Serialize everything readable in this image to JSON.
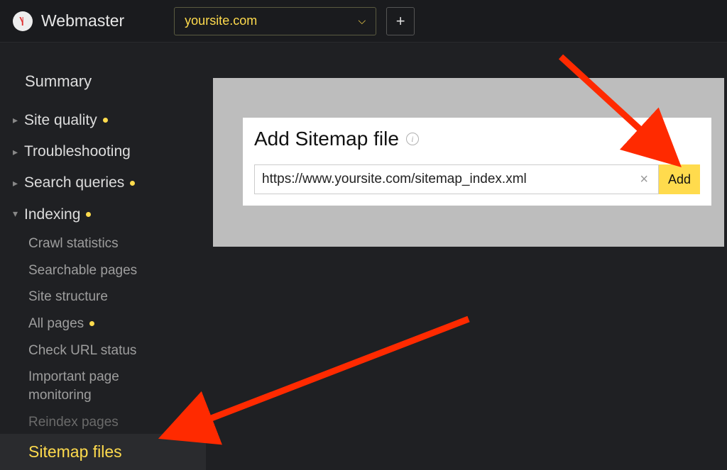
{
  "header": {
    "brand": "Webmaster",
    "site_selector_value": "yoursite.com"
  },
  "sidebar": {
    "summary": "Summary",
    "items": [
      {
        "label": "Site quality",
        "has_dot": true
      },
      {
        "label": "Troubleshooting",
        "has_dot": false
      },
      {
        "label": "Search queries",
        "has_dot": true
      },
      {
        "label": "Indexing",
        "has_dot": true
      }
    ],
    "indexing_sub": [
      {
        "label": "Crawl statistics",
        "has_dot": false
      },
      {
        "label": "Searchable pages",
        "has_dot": false
      },
      {
        "label": "Site structure",
        "has_dot": false
      },
      {
        "label": "All pages",
        "has_dot": true
      },
      {
        "label": "Check URL status",
        "has_dot": false
      },
      {
        "label": "Important page monitoring",
        "has_dot": false
      },
      {
        "label": "Reindex pages",
        "has_dot": false
      },
      {
        "label": "Sitemap files",
        "has_dot": false,
        "active": true
      }
    ]
  },
  "main": {
    "title": "Add Sitemap file",
    "input_value": "https://www.yoursite.com/sitemap_index.xml",
    "add_button": "Add"
  },
  "colors": {
    "accent_yellow": "#ffdb4d",
    "bg_dark": "#1f2023"
  }
}
